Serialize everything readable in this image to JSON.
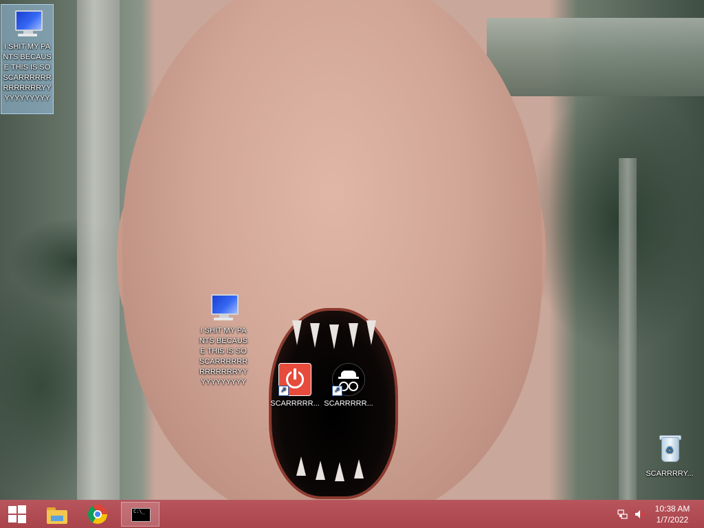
{
  "desktop": {
    "icons": [
      {
        "label": "I SHIT MY PANTS BECAUSE THIS IS SO SCARRRRRRRRRRRRRYYYYYYYYYYY",
        "icon": "computer-icon",
        "selected": true
      },
      {
        "label": "I SHIT MY PANTS BECAUSE THIS IS SO SCARRRRRRRRRRRRRYYYYYYYYYYY",
        "icon": "computer-icon",
        "selected": false
      },
      {
        "label": "SCARRRRR...",
        "icon": "power-icon",
        "shortcut": true
      },
      {
        "label": "SCARRRRR...",
        "icon": "incognito-icon",
        "shortcut": true
      },
      {
        "label": "SCARRRRY...",
        "icon": "recycle-bin-icon"
      }
    ]
  },
  "taskbar": {
    "pinned": [
      {
        "name": "file-explorer",
        "icon": "folder-icon"
      },
      {
        "name": "chrome",
        "icon": "chrome-icon"
      },
      {
        "name": "command-prompt",
        "icon": "cmd-icon",
        "active": true
      }
    ],
    "cmd_glyph": "C:\\_",
    "tray": {
      "network_icon": "network-icon",
      "volume_icon": "volume-muted-icon"
    },
    "clock": {
      "time": "10:38 AM",
      "date": "1/7/2022"
    }
  },
  "colors": {
    "taskbar": "#ad4450",
    "selection": "#99c4e8"
  }
}
